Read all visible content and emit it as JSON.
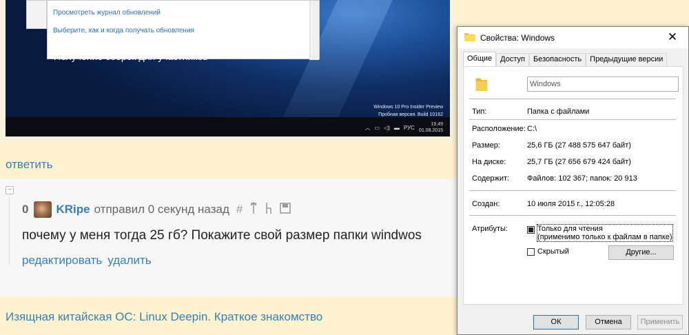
{
  "screenshot": {
    "link_updates_log": "Просмотреть журнал обновлений",
    "link_update_choice": "Выберите, как и когда получать обновления",
    "cut_heading": "Получение сборок для участников",
    "watermark_line1": "Windows 10 Pro Insider Preview",
    "watermark_line2": "Пробная версия. Build 10162",
    "tray_lang": "РУС",
    "clock_time": "15:49",
    "clock_date": "01.08.2015"
  },
  "forum": {
    "reply_link": "ответить",
    "collapse_symbol": "⊟",
    "comment": {
      "score": "0",
      "author": "KRipe",
      "meta": "отправил 0 секунд назад",
      "action_icons": [
        "#",
        "↑",
        "↓",
        "💾"
      ],
      "text": "почему у меня тогда 25 гб? Покажите свой размер папки windwos",
      "edit_link": "редактировать",
      "delete_link": "удалить"
    },
    "next_topic_link": "Изящная китайская ОС: Linux Deepin. Краткое знакомство"
  },
  "dialog": {
    "title": "Свойства: Windows",
    "close_symbol": "✕",
    "tabs": [
      "Общие",
      "Доступ",
      "Безопасность",
      "Предыдущие версии"
    ],
    "active_tab": 0,
    "folder_name": "Windows",
    "rows": [
      {
        "label": "Тип:",
        "value": "Папка с файлами"
      },
      {
        "label": "Расположение:",
        "value": "C:\\"
      },
      {
        "label": "Размер:",
        "value": "25,6 ГБ (27 488 575 647 байт)"
      },
      {
        "label": "На диске:",
        "value": "25,7 ГБ (27 656 679 424 байт)"
      },
      {
        "label": "Содержит:",
        "value": "Файлов: 102 367; папок: 20 913"
      },
      {
        "label": "Создан:",
        "value": "10 июля 2015 г., 12:05:28"
      }
    ],
    "attributes_label": "Атрибуты:",
    "readonly_label_1": "Только для чтения",
    "readonly_label_2": "(применимо только к файлам в папке)",
    "hidden_label": "Скрытый",
    "other_button": "Другие...",
    "ok_button": "ОК",
    "cancel_button": "Отмена",
    "apply_button": "Применить",
    "folder_color": "#f3c549"
  }
}
